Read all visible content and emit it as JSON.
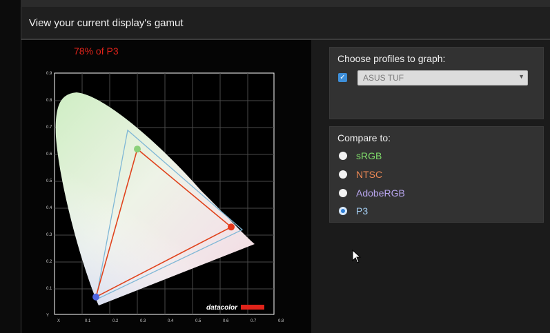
{
  "window": {
    "title": "View your current display's gamut"
  },
  "gamut": {
    "coverage_label": "78% of P3",
    "watermark": "datacolor",
    "axis": {
      "x_ticks": [
        "X",
        "0.1",
        "0.2",
        "0.3",
        "0.4",
        "0.5",
        "0.6",
        "0.7",
        "0.8"
      ],
      "y_ticks": [
        "0.9",
        "0.8",
        "0.7",
        "0.6",
        "0.5",
        "0.4",
        "0.3",
        "0.2",
        "0.1",
        "Y"
      ]
    },
    "display_triangle": {
      "color": "#e0431d",
      "red": [
        0.64,
        0.33
      ],
      "green": [
        0.3,
        0.62
      ],
      "blue": [
        0.15,
        0.07
      ]
    },
    "reference_triangle": {
      "color": "#7fb7d6",
      "red": [
        0.68,
        0.32
      ],
      "green": [
        0.265,
        0.69
      ],
      "blue": [
        0.15,
        0.06
      ]
    }
  },
  "profiles": {
    "label": "Choose profiles to graph:",
    "checkbox_checked": true,
    "selected_profile": "ASUS TUF"
  },
  "compare": {
    "label": "Compare to:",
    "options": [
      {
        "label": "sRGB",
        "color": "#7fdc6a",
        "selected": false
      },
      {
        "label": "NTSC",
        "color": "#f08a55",
        "selected": false
      },
      {
        "label": "AdobeRGB",
        "color": "#b9a6f0",
        "selected": false
      },
      {
        "label": "P3",
        "color": "#a6d0f5",
        "selected": true
      }
    ]
  }
}
